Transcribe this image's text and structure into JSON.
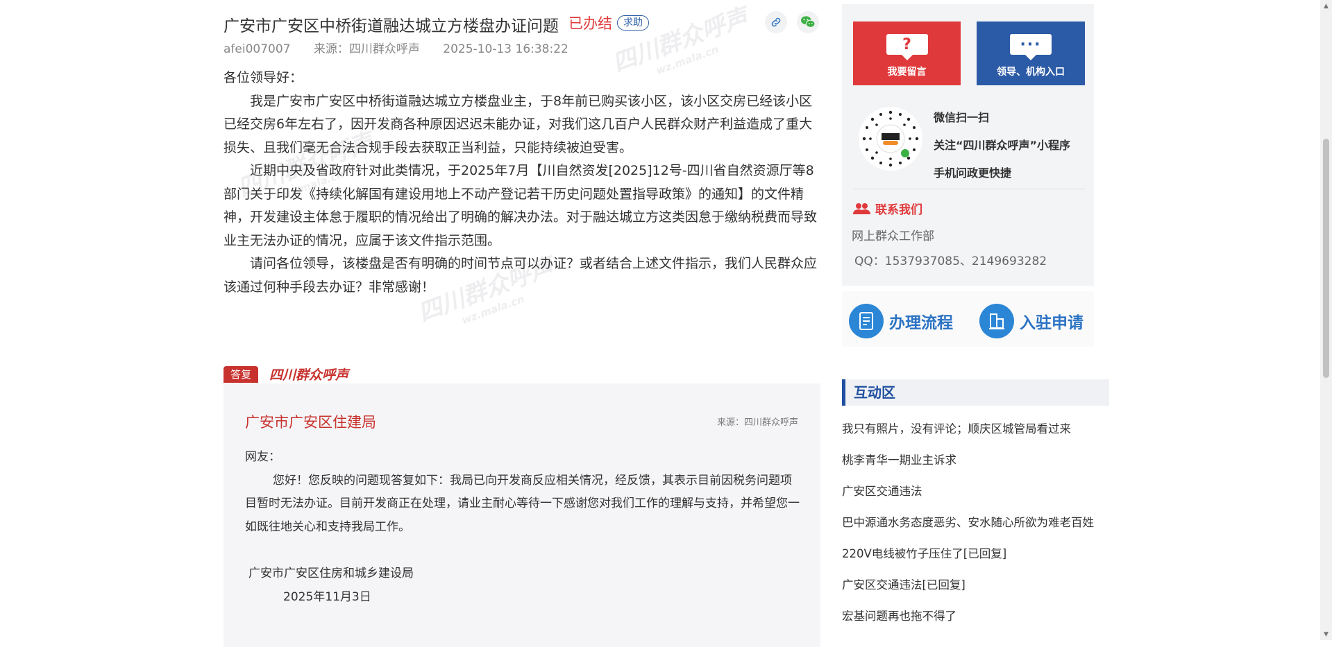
{
  "article": {
    "title": "广安市广安区中桥街道融达城立方楼盘办证问题",
    "status": "已办结",
    "tag": "求助",
    "author": "afei007007",
    "source": "来源：四川群众呼声",
    "datetime": "2025-10-13 16:38:22",
    "salutation": "各位领导好：",
    "paragraphs": [
      "我是广安市广安区中桥街道融达城立方楼盘业主，于8年前已购买该小区，该小区交房已经该小区已经交房6年左右了，因开发商各种原因迟迟未能办证，对我们这几百户人民群众财产利益造成了重大损失、且我们毫无合法合规手段去获取正当利益，只能持续被迫受害。",
      "近期中央及省政府针对此类情况，于2025年7月【川自然资发[2025]12号-四川省自然资源厅等8部门关于印发《持续化解国有建设用地上不动产登记若干历史问题处置指导政策》的通知】的文件精神，开发建设主体怠于履职的情况给出了明确的解决办法。对于融达城立方这类因怠于缴纳税费而导致业主无法办证的情况，应属于该文件指示范围。",
      "请问各位领导，该楼盘是否有明确的时间节点可以办证？或者结合上述文件指示，我们人民群众应该通过何种手段去办证？非常感谢！"
    ]
  },
  "reply": {
    "tag": "答复",
    "brand": "四川群众呼声",
    "unit": "广安市广安区住建局",
    "source": "来源：四川群众呼声",
    "greeting": "网友：",
    "content": "您好！您反映的问题现答复如下：我局已向开发商反应相关情况，经反馈，其表示目前因税务问题项目暂时无法办证。目前开发商正在处理，请业主耐心等待一下感谢您对我们工作的理解与支持，并希望您一如既往地关心和支持我局工作。",
    "signature": "广安市广安区住房和城乡建设局",
    "date": "2025年11月3日"
  },
  "sidebar": {
    "btn_message": "我要留言",
    "btn_leader": "领导、机构入口",
    "qr_lines": [
      "微信扫一扫",
      "关注“四川群众呼声”小程序",
      "手机问政更快捷"
    ],
    "contact_title": "联系我们",
    "contact_org": "网上群众工作部",
    "contact_qq": "QQ：1537937085、2149693282",
    "flow_process": "办理流程",
    "flow_join": "入驻申请",
    "interaction_title": "互动区",
    "interaction_items": [
      "我只有照片，没有评论；顺庆区城管局看过来",
      "桃李青华一期业主诉求",
      "广安区交通违法",
      "巴中源通水务态度恶劣、安水随心所欲为难老百姓",
      "220V电线被竹子压住了[已回复]",
      "广安区交通违法[已回复]",
      "宏基问题再也拖不得了"
    ]
  },
  "colors": {
    "accent_red": "#e03b3b",
    "brand_blue": "#2b5aa6",
    "flow_blue": "#2b73c4"
  }
}
